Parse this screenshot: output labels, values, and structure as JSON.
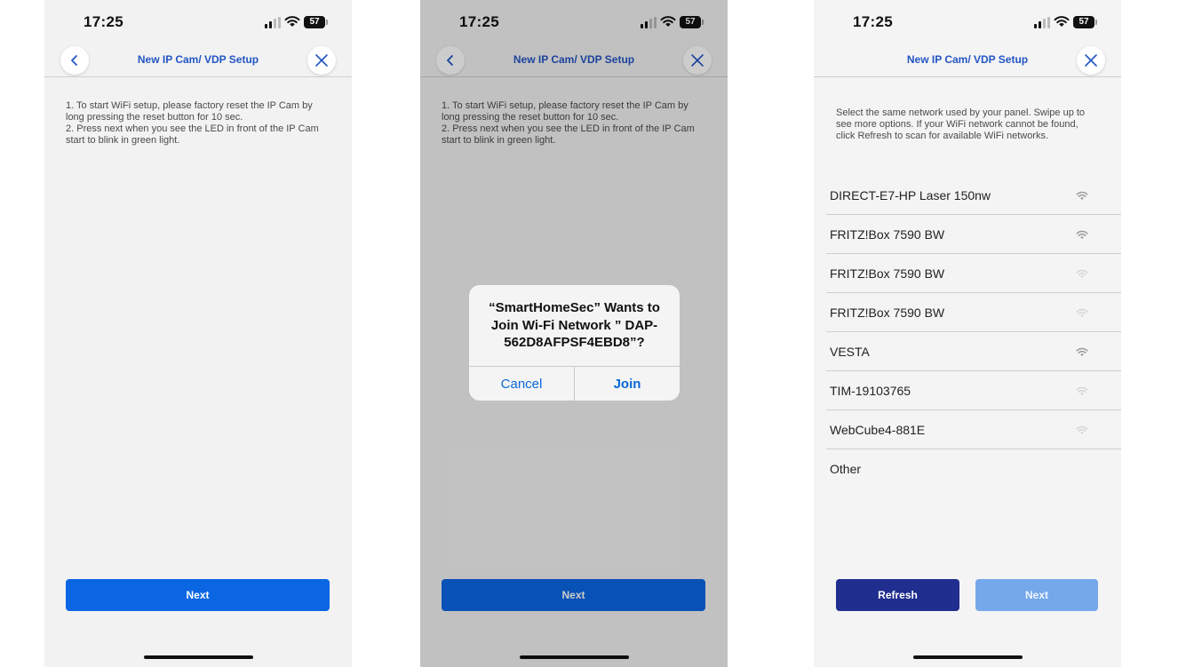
{
  "status_bar": {
    "time": "17:25",
    "battery": "57"
  },
  "header": {
    "title": "New IP Cam/ VDP Setup"
  },
  "reset_instructions": {
    "line1": "1. To start WiFi setup, please factory reset the IP Cam by long pressing the reset button for 10 sec.",
    "line2": " 2. Press next when you see the LED in front of the IP Cam start to blink in green light."
  },
  "buttons": {
    "next": "Next",
    "refresh": "Refresh"
  },
  "alert": {
    "message": "“SmartHomeSec” Wants to Join Wi-Fi Network ” DAP-562D8AFPSF4EBD8”?",
    "cancel": "Cancel",
    "join": "Join"
  },
  "network_screen": {
    "intro": "Select the same network used by your panel. Swipe up to see more options. If your WiFi network cannot be found, click Refresh to scan for available WiFi networks.",
    "networks": [
      {
        "name": "DIRECT-E7-HP Laser 150nw",
        "signal": "strong"
      },
      {
        "name": "FRITZ!Box 7590 BW",
        "signal": "strong"
      },
      {
        "name": "FRITZ!Box 7590 BW",
        "signal": "weak"
      },
      {
        "name": "FRITZ!Box 7590 BW",
        "signal": "weak"
      },
      {
        "name": "VESTA",
        "signal": "strong"
      },
      {
        "name": "TIM-19103765",
        "signal": "weak"
      },
      {
        "name": "WebCube4-881E",
        "signal": "weak"
      }
    ],
    "other": "Other"
  },
  "icons": {
    "back": "chevron-left-icon",
    "close": "close-icon",
    "cellular": "cellular-signal-icon",
    "wifi": "wifi-icon",
    "battery": "battery-icon"
  },
  "colors": {
    "accent": "#0b66e4",
    "title_blue": "#2255c4",
    "refresh_navy": "#1f2e8f",
    "next_disabled": "#74a8eb",
    "alert_action": "#0a67d9",
    "signal_strong": "#9a9a9a",
    "signal_weak": "#d6d6d6"
  }
}
